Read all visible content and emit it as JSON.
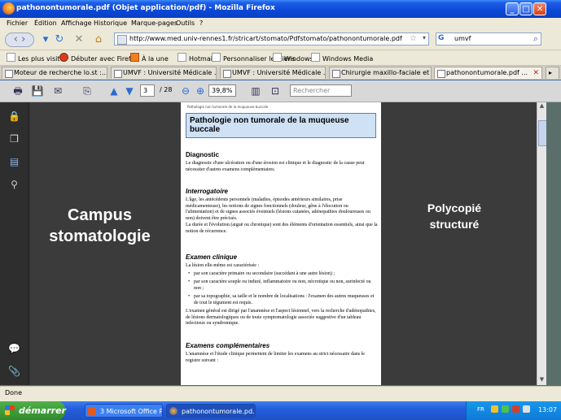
{
  "window": {
    "title": "pathonontumorale.pdf (Objet application/pdf) - Mozilla Firefox",
    "minimize_glyph": "_",
    "maximize_glyph": "□",
    "close_glyph": "✕"
  },
  "menu": [
    "Fichier",
    "Édition",
    "Affichage",
    "Historique",
    "Marque-pages",
    "Outils",
    "?"
  ],
  "nav": {
    "url": "http://www.med.univ-rennes1.fr/stricart/stomato/Pdfstomato/pathonontumorale.pdf",
    "search_engine": "G",
    "search_value": "umvf"
  },
  "bookmarks": [
    "Les plus visités",
    "Débuter avec Firefox",
    "À la une",
    "Hotmail",
    "Personnaliser les liens",
    "Windows",
    "Windows Media"
  ],
  "tabs": [
    {
      "label": "Moteur de recherche lo.st :..."
    },
    {
      "label": "UMVF : Université Médicale ..."
    },
    {
      "label": "UMVF : Université Médicale ..."
    },
    {
      "label": "Chirurgie maxillo-faciale et ..."
    },
    {
      "label": "pathonontumorale.pdf ...",
      "active": true
    }
  ],
  "pdf_toolbar": {
    "page_current": "3",
    "page_total": "/ 28",
    "zoom": "39,8%",
    "search_placeholder": "Rechercher"
  },
  "overlay": {
    "left_text": "Campus stomatologie",
    "right_text": "Polycopié structuré"
  },
  "pdf_page": {
    "header": "Pathologie non tumorale de la muqueuse buccale",
    "title": "Pathologie non tumorale de la muqueuse buccale",
    "sections": {
      "diagnostic": {
        "heading": "Diagnostic",
        "text": "Le diagnostic d'une ulcération ou d'une érosion est clinique et le diagnostic de la cause peut nécessiter d'autres examens complémentaires."
      },
      "interrogatoire": {
        "heading": "Interrogatoire",
        "text": "L'âge, les antécédents personnels (maladies, épisodes antérieurs similaires, prise médicamenteuse), les notions de signes fonctionnels (douleur, gêne à l'élocution ou l'alimentation) et de signes associés éventuels (lésions cutanées, adénopathies douloureuses ou non) doivent être précisés.",
        "text2": "La durée et l'évolution (aiguë ou chronique) sont des éléments d'orientation essentiels, ainsi que la notion de récurrence."
      },
      "examen": {
        "heading": "Examen clinique",
        "intro": "La lésion elle-même est caractérisée :",
        "items": [
          "par son caractère primaire ou secondaire (succédant à une autre lésion) ;",
          "par son caractère souple ou induré, inflammatoire ou non, nécrotique ou non, surinfecté ou non ;",
          "par sa topographie, sa taille et le nombre de localisations : l'examen des autres muqueuses et de tout le tégument est requis."
        ],
        "outro": "L'examen général est dirigé par l'anamnèse et l'aspect lésionnel, vers la recherche d'adénopathies, de lésions dermatologiques ou de toute symptomatologie associée suggestive d'un tableau infectieux ou syndromique."
      },
      "complementaires": {
        "heading": "Examens complémentaires",
        "text": "L'anamnèse et l'étude clinique permettent de limiter les examens au strict nécessaire dans le registre suivant :"
      }
    }
  },
  "status": "Done",
  "taskbar": {
    "start": "démarrer",
    "items": [
      {
        "label": "3 Microsoft Office P..."
      },
      {
        "label": "pathonontumorale.pd...",
        "active": true
      }
    ],
    "lang": "FR",
    "clock": "13:07"
  }
}
